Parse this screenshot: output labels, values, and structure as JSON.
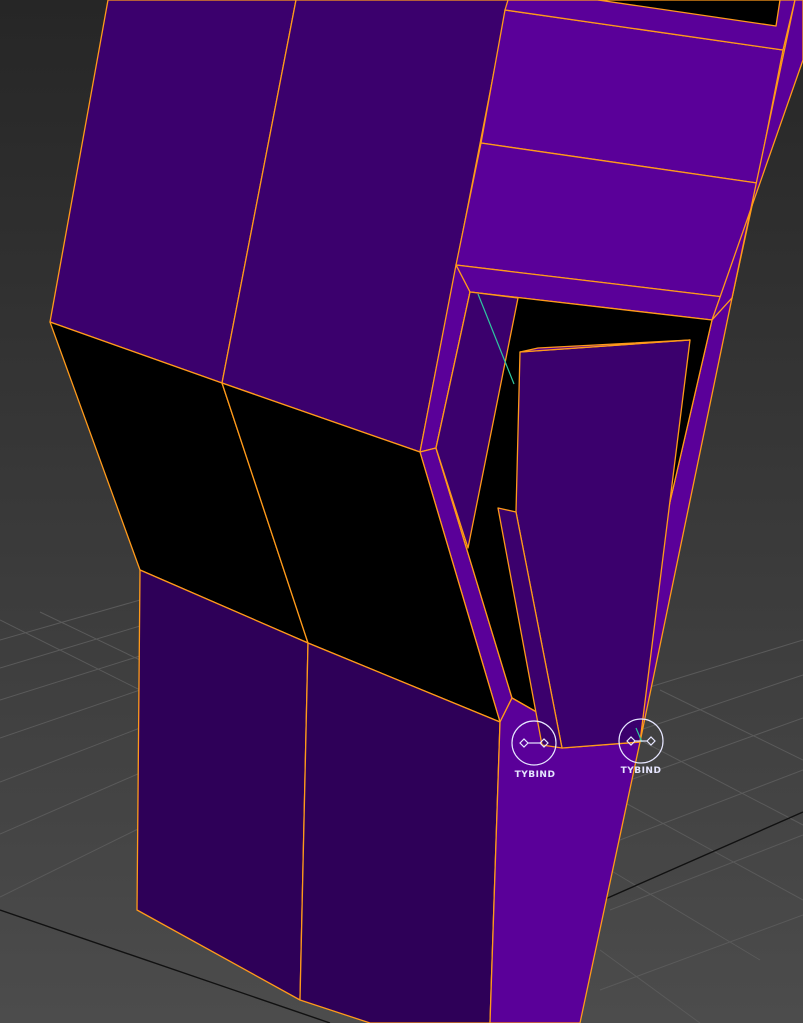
{
  "viewport": {
    "colors": {
      "background_top": "#262626",
      "background_bottom": "#4c4c4c",
      "grid_line": "#5a5a5a",
      "grid_axis": "#111111",
      "selection_edge": "#ff9a1a",
      "face_light": "#5a0099",
      "face_mid": "#3b006d",
      "face_dark": "#2e0058",
      "face_black": "#000000",
      "helper_line": "#2fc7a0",
      "helper_icon": "#e6e6ff"
    }
  },
  "helpers": [
    {
      "id": "tybind-left",
      "label": "TYBIND",
      "icon": "bind-helper-icon"
    },
    {
      "id": "tybind-right",
      "label": "TYBIND",
      "icon": "bind-helper-icon"
    }
  ]
}
